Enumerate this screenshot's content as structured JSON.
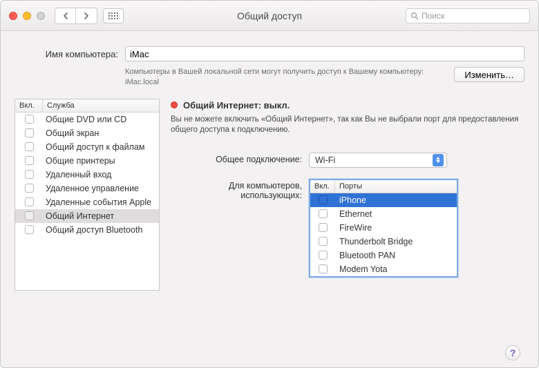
{
  "window": {
    "title": "Общий доступ"
  },
  "toolbar": {
    "search_placeholder": "Поиск"
  },
  "computerName": {
    "label": "Имя компьютера:",
    "value": "iMac",
    "description": "Компьютеры в Вашей локальной сети могут получить доступ к Вашему компьютеру: iMac.local",
    "editButton": "Изменить…"
  },
  "serviceTable": {
    "headers": {
      "enabled": "Вкл.",
      "service": "Служба"
    },
    "rows": [
      {
        "enabled": false,
        "name": "Общие DVD или CD",
        "selected": false
      },
      {
        "enabled": false,
        "name": "Общий экран",
        "selected": false
      },
      {
        "enabled": false,
        "name": "Общий доступ к файлам",
        "selected": false
      },
      {
        "enabled": false,
        "name": "Общие принтеры",
        "selected": false
      },
      {
        "enabled": false,
        "name": "Удаленный вход",
        "selected": false
      },
      {
        "enabled": false,
        "name": "Удаленное управление",
        "selected": false
      },
      {
        "enabled": false,
        "name": "Удаленные события Apple",
        "selected": false
      },
      {
        "enabled": false,
        "name": "Общий Интернет",
        "selected": true
      },
      {
        "enabled": false,
        "name": "Общий доступ Bluetooth",
        "selected": false
      }
    ]
  },
  "detail": {
    "statusTitle": "Общий Интернет: выкл.",
    "statusColor": "#ef4b3e",
    "statusDesc": "Вы не можете включить «Общий Интернет», так как Вы не выбрали порт для предоставления общего доступа к подключению.",
    "shareLabel": "Общее подключение:",
    "shareValue": "Wi-Fi",
    "toLabel": "Для компьютеров, использующих:",
    "portsHeaders": {
      "enabled": "Вкл.",
      "ports": "Порты"
    },
    "ports": [
      {
        "enabled": false,
        "name": "iPhone",
        "selected": true
      },
      {
        "enabled": false,
        "name": "Ethernet",
        "selected": false
      },
      {
        "enabled": false,
        "name": "FireWire",
        "selected": false
      },
      {
        "enabled": false,
        "name": "Thunderbolt Bridge",
        "selected": false
      },
      {
        "enabled": false,
        "name": "Bluetooth PAN",
        "selected": false
      },
      {
        "enabled": false,
        "name": "Modem Yota",
        "selected": false
      }
    ]
  },
  "help": "?"
}
